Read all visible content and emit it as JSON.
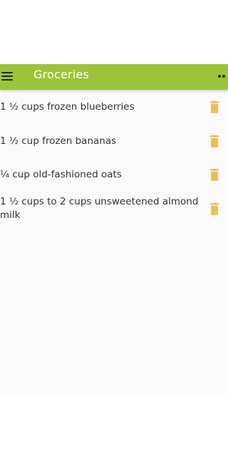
{
  "appbar": {
    "title": "Groceries",
    "menu_icon": "menu-icon",
    "more_icon": "more-horiz-icon",
    "color": "#9bc43a"
  },
  "items": [
    {
      "text": "1 ½ cups frozen blueberries",
      "action_icon": "trash-icon"
    },
    {
      "text": "1 ½ cup frozen bananas",
      "action_icon": "trash-icon"
    },
    {
      "text": "¼ cup old-fashioned oats",
      "action_icon": "trash-icon"
    },
    {
      "text": "1 ½ cups to 2 cups unsweetened almond milk",
      "action_icon": "trash-icon"
    }
  ],
  "colors": {
    "trash_icon": "#f1c15c",
    "background": "#fafafa"
  }
}
